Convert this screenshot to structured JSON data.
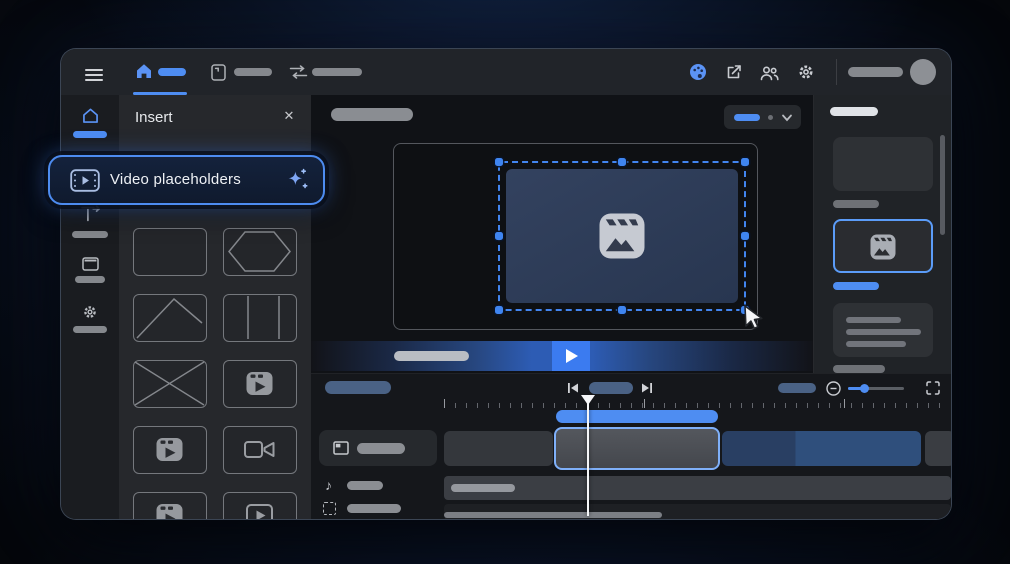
{
  "topbar": {
    "menu_icon": "hamburger-icon",
    "tabs": [
      {
        "id": "home",
        "icon": "home-icon",
        "active": true
      },
      {
        "id": "templates",
        "icon": "template-icon",
        "active": false
      },
      {
        "id": "tools",
        "icon": "tune-icon",
        "active": false
      }
    ],
    "action_icons": [
      "palette-icon",
      "export-icon",
      "people-icon",
      "settings-icon"
    ],
    "avatar": "user-avatar"
  },
  "insert_panel": {
    "title": "Insert",
    "close_glyph": "✕",
    "grid_items": [
      "blank-frame",
      "hexagon-frame",
      "diagonal-frame",
      "column-frame",
      "cross-frame",
      "film-clip",
      "film-clip",
      "video-camera",
      "film-clip",
      "play-frame"
    ]
  },
  "highlight_item": {
    "label": "Video placeholders",
    "leading_icon": "video-placeholder-icon",
    "trailing_icon": "sparkle-icon"
  },
  "canvas": {
    "selected_element": "video-placeholder",
    "element_icon": "media-clip-icon",
    "player_state": "paused",
    "play_icon": "play-triangle"
  },
  "right_panel": {
    "cards": [
      "scene-thumbnail",
      "selected-media-thumbnail",
      "text-lines-thumbnail"
    ],
    "selected_index": 1
  },
  "timeline": {
    "transport": [
      "skip-previous",
      "current-time",
      "skip-next"
    ],
    "zoom_controls": [
      "zoom-out",
      "zoom-slider",
      "fit-screen"
    ],
    "tracks": [
      {
        "icon": "frame-track-icon",
        "clips": [
          "clip-gray",
          "clip-selected",
          "clip-blue-two-tone",
          "clip-sliver"
        ]
      },
      {
        "icon": "music-note-icon",
        "note_glyph": "♪",
        "clips": [
          "audio-bar"
        ]
      },
      {
        "icon": "dashed-track-icon",
        "clips": []
      }
    ]
  },
  "colors": {
    "accent": "#4e8df2",
    "selection_border": "#7fb0f9",
    "clip_blue_dark": "#293f63",
    "clip_blue_light": "#2f4f7c",
    "placeholder_fill": "#2e3c57",
    "window_bg": "#1d2024"
  }
}
